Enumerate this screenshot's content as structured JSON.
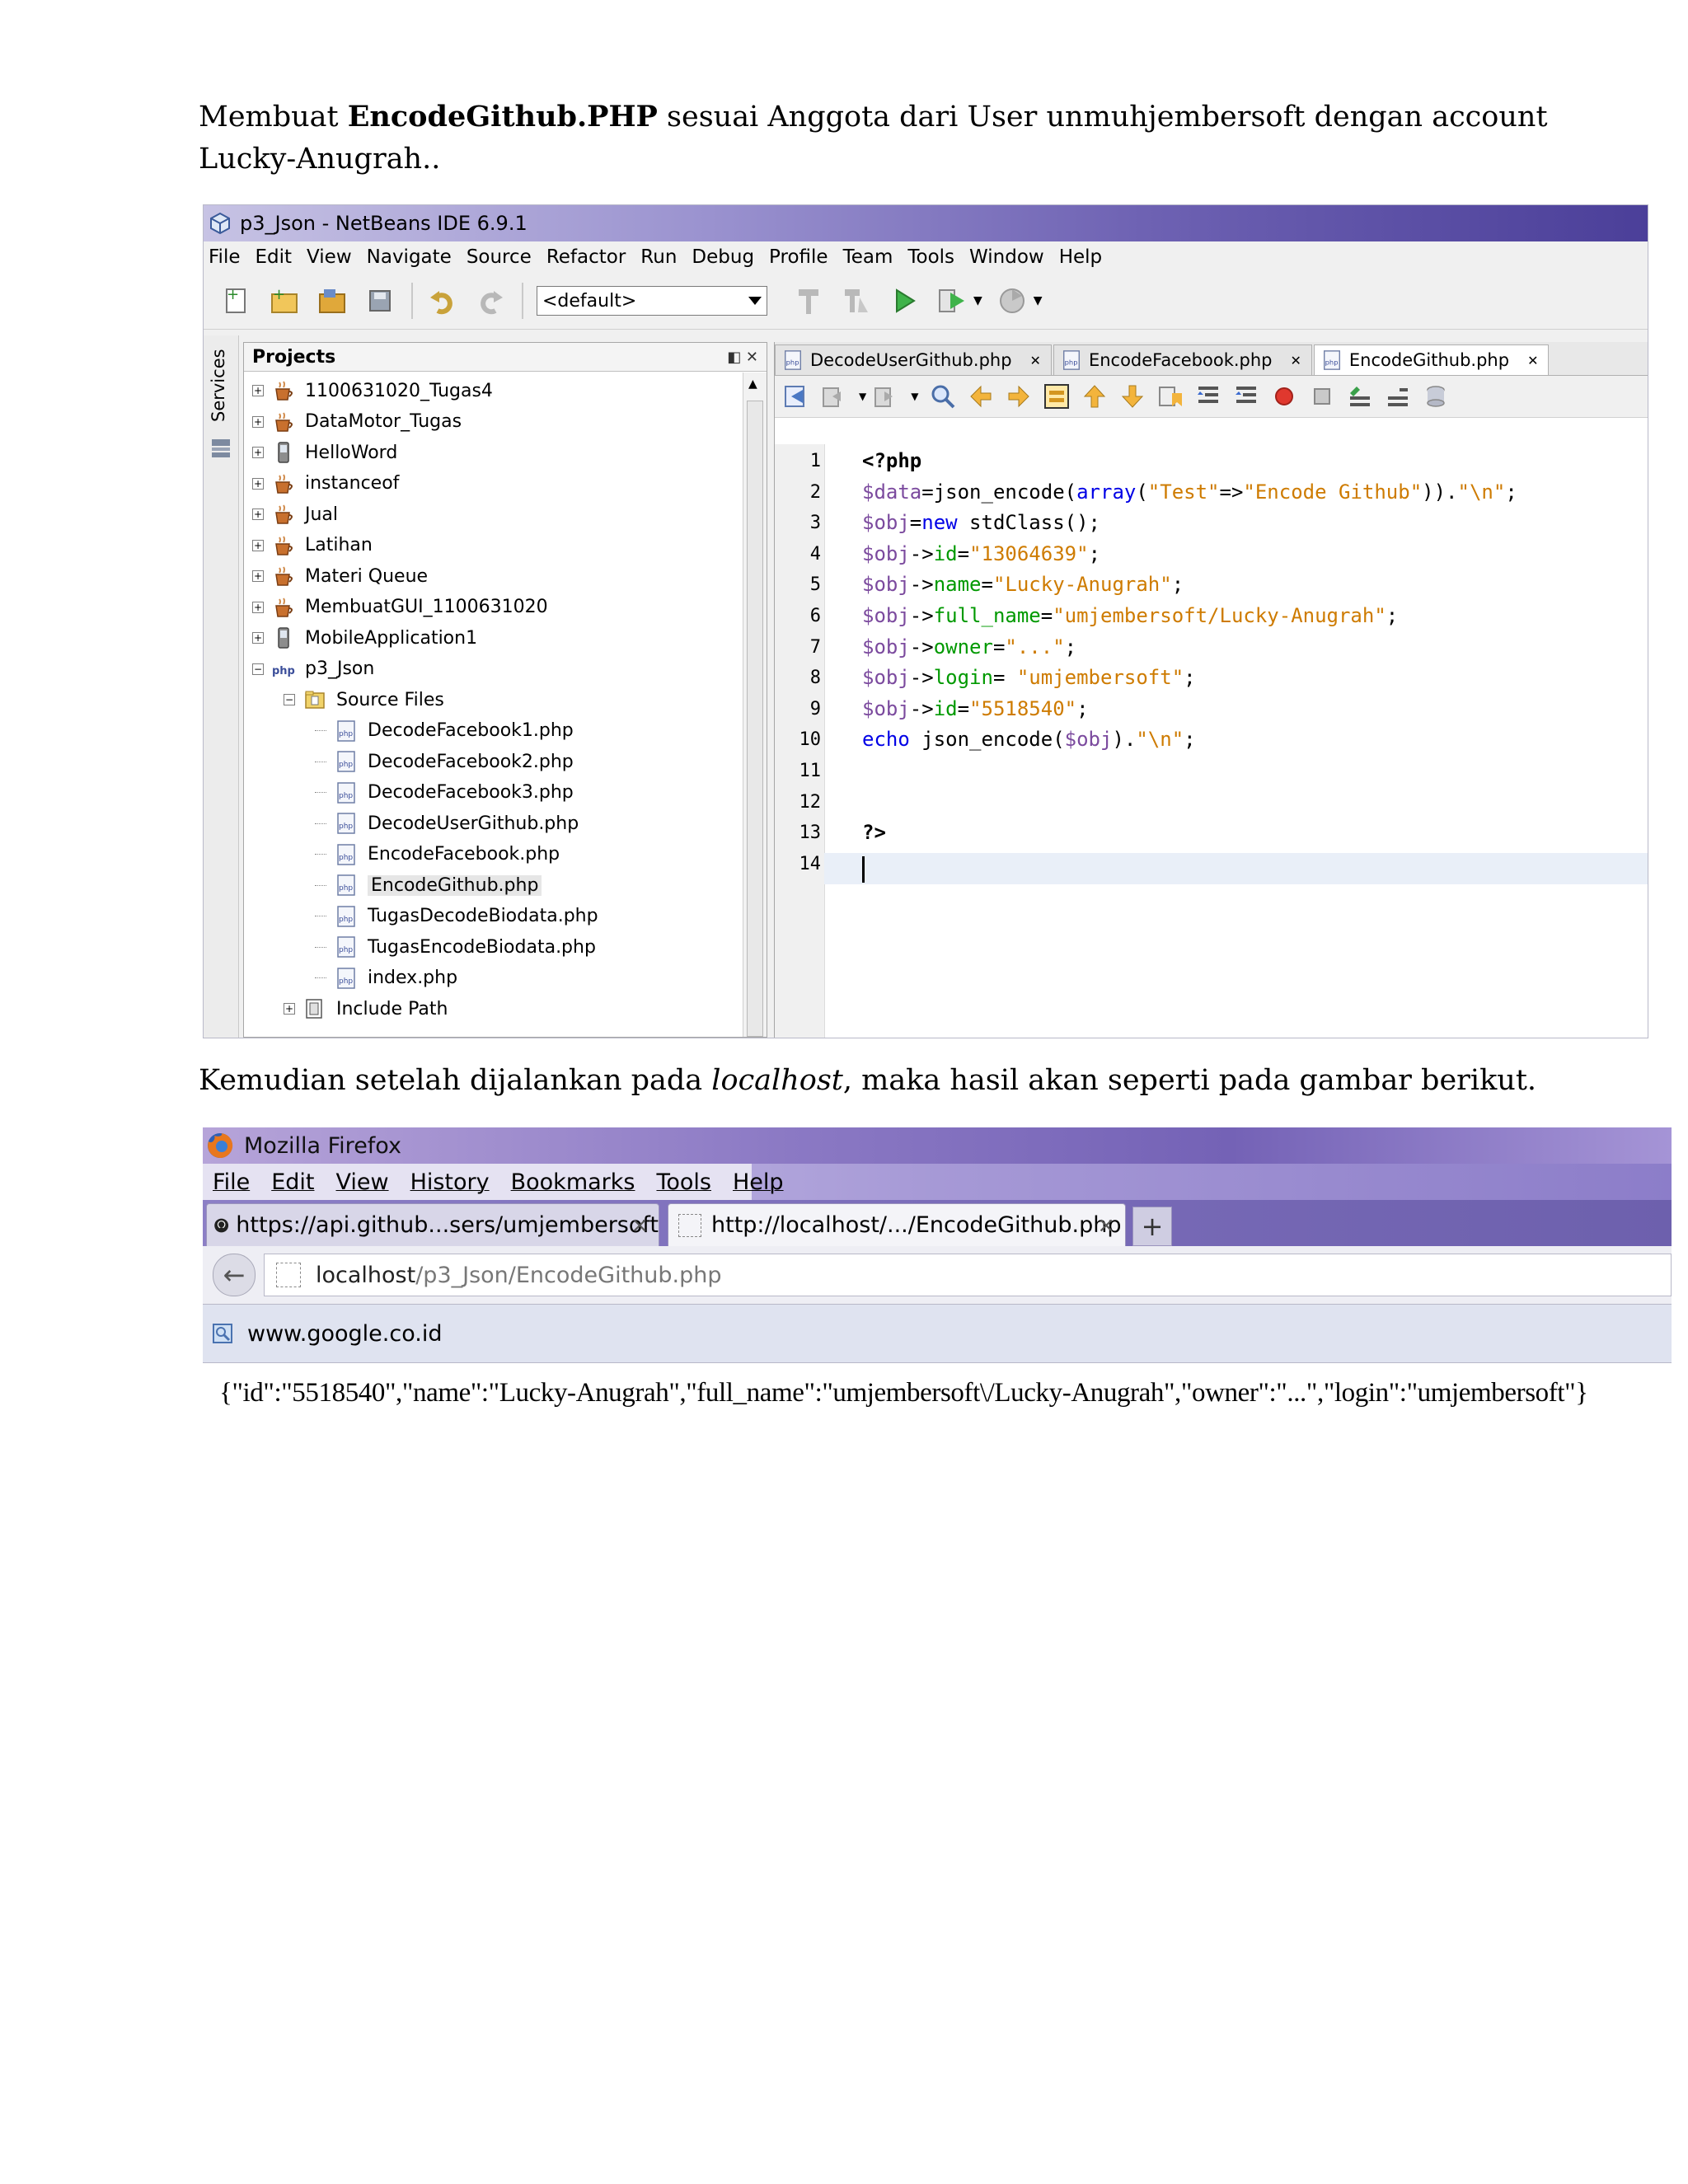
{
  "intro": {
    "prefix": "Membuat ",
    "bold": "EncodeGithub.PHP",
    "rest": " sesuai Anggota dari User unmuhjembersoft dengan account Lucky-Anugrah.."
  },
  "outro": {
    "prefix": "Kemudian setelah dijalankan pada ",
    "italic": "localhost",
    "rest": ", maka hasil akan seperti pada gambar berikut."
  },
  "netbeans": {
    "title": "p3_Json - NetBeans IDE 6.9.1",
    "menu": [
      "File",
      "Edit",
      "View",
      "Navigate",
      "Source",
      "Refactor",
      "Run",
      "Debug",
      "Profile",
      "Team",
      "Tools",
      "Window",
      "Help"
    ],
    "config_combo": "<default>",
    "services_label": "Services",
    "projects_title": "Projects",
    "tree": [
      {
        "label": "1100631020_Tugas4",
        "icon": "coffee-cup-icon",
        "depth": 0,
        "expander": "+"
      },
      {
        "label": "DataMotor_Tugas",
        "icon": "coffee-cup-icon",
        "depth": 0,
        "expander": "+"
      },
      {
        "label": "HelloWord",
        "icon": "phone-icon",
        "depth": 0,
        "expander": "+"
      },
      {
        "label": "instanceof",
        "icon": "coffee-cup-icon",
        "depth": 0,
        "expander": "+"
      },
      {
        "label": "Jual",
        "icon": "coffee-cup-icon",
        "depth": 0,
        "expander": "+"
      },
      {
        "label": "Latihan",
        "icon": "coffee-cup-icon",
        "depth": 0,
        "expander": "+"
      },
      {
        "label": "Materi Queue",
        "icon": "coffee-cup-icon",
        "depth": 0,
        "expander": "+"
      },
      {
        "label": "MembuatGUI_1100631020",
        "icon": "coffee-cup-icon",
        "depth": 0,
        "expander": "+"
      },
      {
        "label": "MobileApplication1",
        "icon": "phone-icon",
        "depth": 0,
        "expander": "+"
      },
      {
        "label": "p3_Json",
        "icon": "php-project-icon",
        "depth": 0,
        "expander": "−"
      },
      {
        "label": "Source Files",
        "icon": "folder-icon",
        "depth": 1,
        "expander": "−"
      },
      {
        "label": "DecodeFacebook1.php",
        "icon": "php-file-icon",
        "depth": 2,
        "expander": ""
      },
      {
        "label": "DecodeFacebook2.php",
        "icon": "php-file-icon",
        "depth": 2,
        "expander": ""
      },
      {
        "label": "DecodeFacebook3.php",
        "icon": "php-file-icon",
        "depth": 2,
        "expander": ""
      },
      {
        "label": "DecodeUserGithub.php",
        "icon": "php-file-icon",
        "depth": 2,
        "expander": ""
      },
      {
        "label": "EncodeFacebook.php",
        "icon": "php-file-icon",
        "depth": 2,
        "expander": ""
      },
      {
        "label": "EncodeGithub.php",
        "icon": "php-file-icon",
        "depth": 2,
        "expander": "",
        "selected": true
      },
      {
        "label": "TugasDecodeBiodata.php",
        "icon": "php-file-icon",
        "depth": 2,
        "expander": ""
      },
      {
        "label": "TugasEncodeBiodata.php",
        "icon": "php-file-icon",
        "depth": 2,
        "expander": ""
      },
      {
        "label": "index.php",
        "icon": "php-file-icon",
        "depth": 2,
        "expander": ""
      },
      {
        "label": "Include Path",
        "icon": "library-icon",
        "depth": 1,
        "expander": "+"
      }
    ],
    "editor_tabs": [
      {
        "label": "DecodeUserGithub.php",
        "active": false
      },
      {
        "label": "EncodeFacebook.php",
        "active": false
      },
      {
        "label": "EncodeGithub.php",
        "active": true
      }
    ],
    "line_numbers": [
      "1",
      "2",
      "3",
      "4",
      "5",
      "6",
      "7",
      "8",
      "9",
      "10",
      "11",
      "12",
      "13",
      "14"
    ],
    "code_lines": [
      [
        {
          "t": "<?php",
          "c": "php"
        }
      ],
      [
        {
          "t": "$data",
          "c": "var"
        },
        {
          "t": "=json_encode(",
          "c": ""
        },
        {
          "t": "array",
          "c": "kw"
        },
        {
          "t": "(",
          "c": ""
        },
        {
          "t": "\"Test\"",
          "c": "str"
        },
        {
          "t": "=>",
          "c": ""
        },
        {
          "t": "\"Encode Github\"",
          "c": "str"
        },
        {
          "t": ")).",
          "c": ""
        },
        {
          "t": "\"\\n\"",
          "c": "str"
        },
        {
          "t": ";",
          "c": ""
        }
      ],
      [
        {
          "t": "$obj",
          "c": "var"
        },
        {
          "t": "=",
          "c": ""
        },
        {
          "t": "new",
          "c": "kw"
        },
        {
          "t": " stdClass();",
          "c": ""
        }
      ],
      [
        {
          "t": "$obj",
          "c": "var"
        },
        {
          "t": "->",
          "c": ""
        },
        {
          "t": "id",
          "c": "prop"
        },
        {
          "t": "=",
          "c": ""
        },
        {
          "t": "\"13064639\"",
          "c": "str"
        },
        {
          "t": ";",
          "c": ""
        }
      ],
      [
        {
          "t": "$obj",
          "c": "var"
        },
        {
          "t": "->",
          "c": ""
        },
        {
          "t": "name",
          "c": "prop"
        },
        {
          "t": "=",
          "c": ""
        },
        {
          "t": "\"Lucky-Anugrah\"",
          "c": "str"
        },
        {
          "t": ";",
          "c": ""
        }
      ],
      [
        {
          "t": "$obj",
          "c": "var"
        },
        {
          "t": "->",
          "c": ""
        },
        {
          "t": "full_name",
          "c": "prop"
        },
        {
          "t": "=",
          "c": ""
        },
        {
          "t": "\"umjembersoft/Lucky-Anugrah\"",
          "c": "str"
        },
        {
          "t": ";",
          "c": ""
        }
      ],
      [
        {
          "t": "$obj",
          "c": "var"
        },
        {
          "t": "->",
          "c": ""
        },
        {
          "t": "owner",
          "c": "prop"
        },
        {
          "t": "=",
          "c": ""
        },
        {
          "t": "\"...\"",
          "c": "str"
        },
        {
          "t": ";",
          "c": ""
        }
      ],
      [
        {
          "t": "$obj",
          "c": "var"
        },
        {
          "t": "->",
          "c": ""
        },
        {
          "t": "login",
          "c": "prop"
        },
        {
          "t": "= ",
          "c": ""
        },
        {
          "t": "\"umjembersoft\"",
          "c": "str"
        },
        {
          "t": ";",
          "c": ""
        }
      ],
      [
        {
          "t": "$obj",
          "c": "var"
        },
        {
          "t": "->",
          "c": ""
        },
        {
          "t": "id",
          "c": "prop"
        },
        {
          "t": "=",
          "c": ""
        },
        {
          "t": "\"5518540\"",
          "c": "str"
        },
        {
          "t": ";",
          "c": ""
        }
      ],
      [
        {
          "t": "echo",
          "c": "kw"
        },
        {
          "t": " json_encode(",
          "c": ""
        },
        {
          "t": "$obj",
          "c": "var"
        },
        {
          "t": ").",
          "c": ""
        },
        {
          "t": "\"\\n\"",
          "c": "str"
        },
        {
          "t": ";",
          "c": ""
        }
      ],
      [],
      [],
      [
        {
          "t": "?>",
          "c": "php"
        }
      ],
      []
    ],
    "colors": {
      "keyword": "#0000e6",
      "string": "#ce7b00",
      "variable": "#7b4a9e",
      "property": "#009900"
    }
  },
  "firefox": {
    "title": "Mozilla Firefox",
    "menu": [
      "File",
      "Edit",
      "View",
      "History",
      "Bookmarks",
      "Tools",
      "Help"
    ],
    "tabs": [
      {
        "label": "https://api.github...sers/umjembersoft",
        "active": false
      },
      {
        "label": "http://localhost/.../EncodeGithub.php",
        "active": true
      }
    ],
    "url_host": "localhost",
    "url_path": "/p3_Json/EncodeGithub.php",
    "bookmark": "www.google.co.id",
    "output": "{\"id\":\"5518540\",\"name\":\"Lucky-Anugrah\",\"full_name\":\"umjembersoft\\/Lucky-Anugrah\",\"owner\":\"...\",\"login\":\"umjembersoft\"}"
  }
}
